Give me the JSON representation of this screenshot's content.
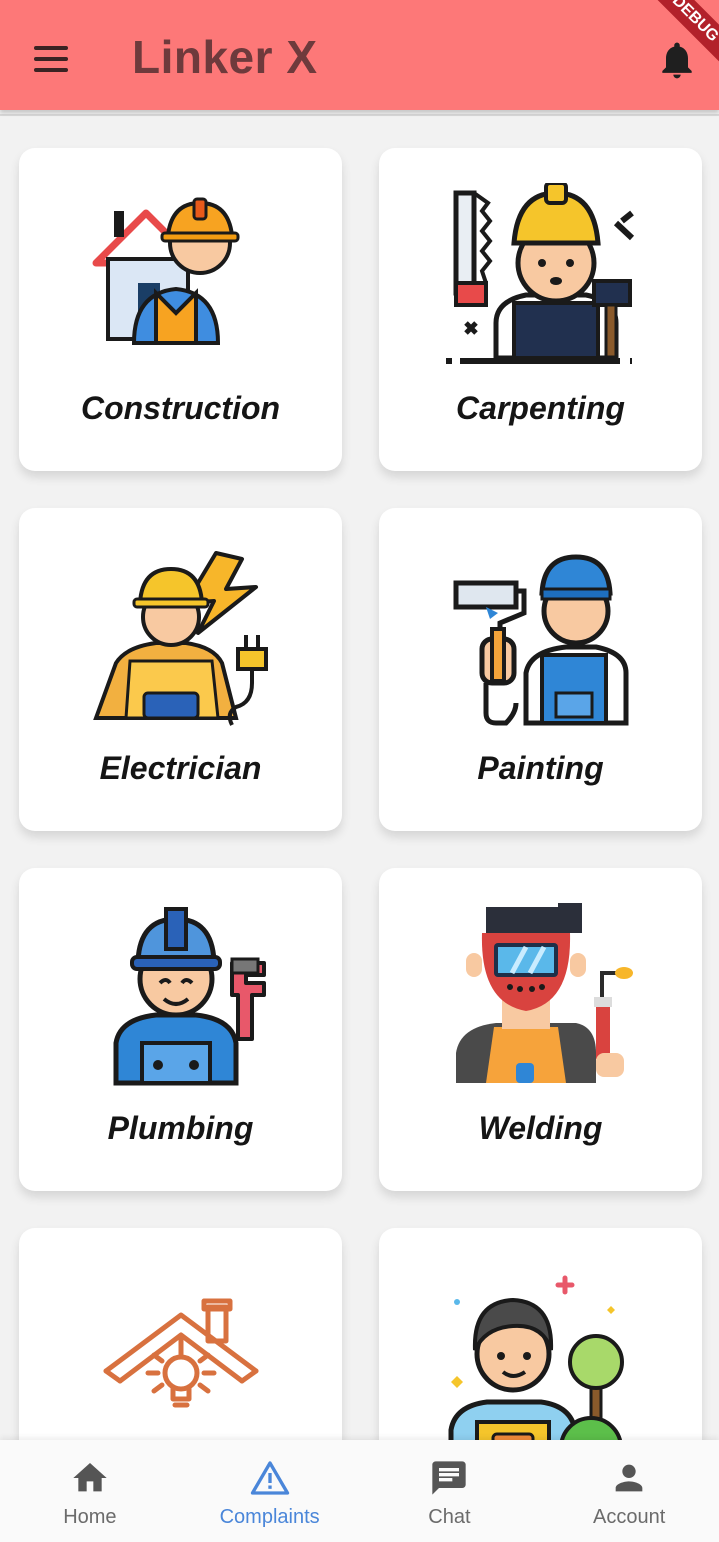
{
  "app_bar": {
    "title": "Linker X",
    "background_color": "#fd7878",
    "menu_icon": "hamburger-menu-icon",
    "notification_icon": "bell-icon",
    "debug_ribbon": "DEBUG"
  },
  "categories": [
    {
      "label": "Construction",
      "icon": "construction-worker-icon"
    },
    {
      "label": "Carpenting",
      "icon": "carpenter-icon"
    },
    {
      "label": "Electrician",
      "icon": "electrician-icon"
    },
    {
      "label": "Painting",
      "icon": "painter-icon"
    },
    {
      "label": "Plumbing",
      "icon": "plumber-icon"
    },
    {
      "label": "Welding",
      "icon": "welder-icon"
    },
    {
      "label": "",
      "icon": "house-light-bulb-icon"
    },
    {
      "label": "",
      "icon": "gardener-icon"
    }
  ],
  "bottom_nav": {
    "active_color": "#4a86d9",
    "items": [
      {
        "label": "Home",
        "icon": "home-icon",
        "active": false
      },
      {
        "label": "Complaints",
        "icon": "warning-triangle-icon",
        "active": true
      },
      {
        "label": "Chat",
        "icon": "chat-bubble-icon",
        "active": false
      },
      {
        "label": "Account",
        "icon": "person-icon",
        "active": false
      }
    ]
  }
}
